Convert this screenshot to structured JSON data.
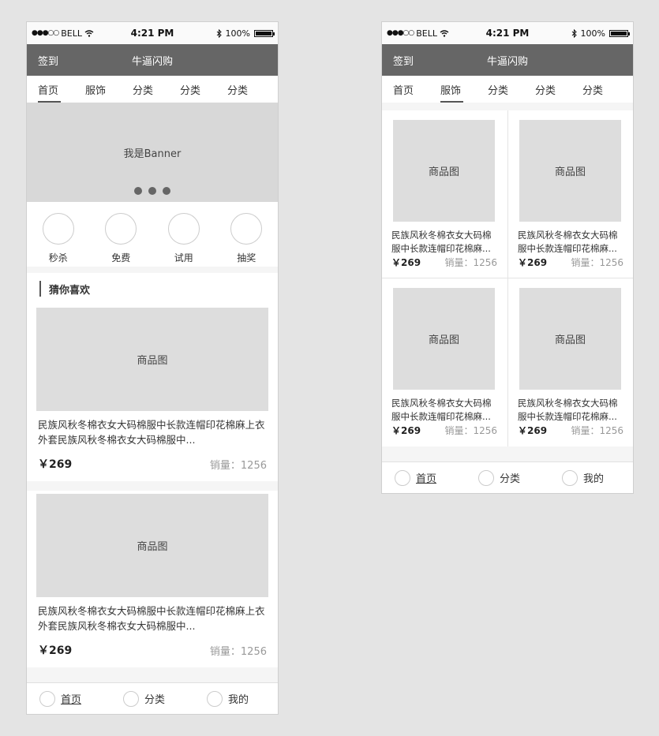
{
  "status": {
    "carrier": "BELL",
    "time": "4:21 PM",
    "battery": "100%",
    "signal_dots": "●●●○○"
  },
  "nav": {
    "left": "签到",
    "title": "牛逼闪购"
  },
  "tabs": [
    "首页",
    "服饰",
    "分类",
    "分类",
    "分类"
  ],
  "banner": {
    "text": "我是Banner"
  },
  "quick": [
    "秒杀",
    "免费",
    "试用",
    "抽奖"
  ],
  "section_title": "猜你喜欢",
  "product": {
    "image_label": "商品图",
    "desc_long": "民族风秋冬棉衣女大码棉服中长款连帽印花棉麻上衣外套民族风秋冬棉衣女大码棉服中...",
    "desc_short": "民族风秋冬棉衣女大码棉服中长款连帽印花棉麻...",
    "price": "￥269",
    "sales": "销量：1256"
  },
  "tabbar": [
    "首页",
    "分类",
    "我的"
  ]
}
